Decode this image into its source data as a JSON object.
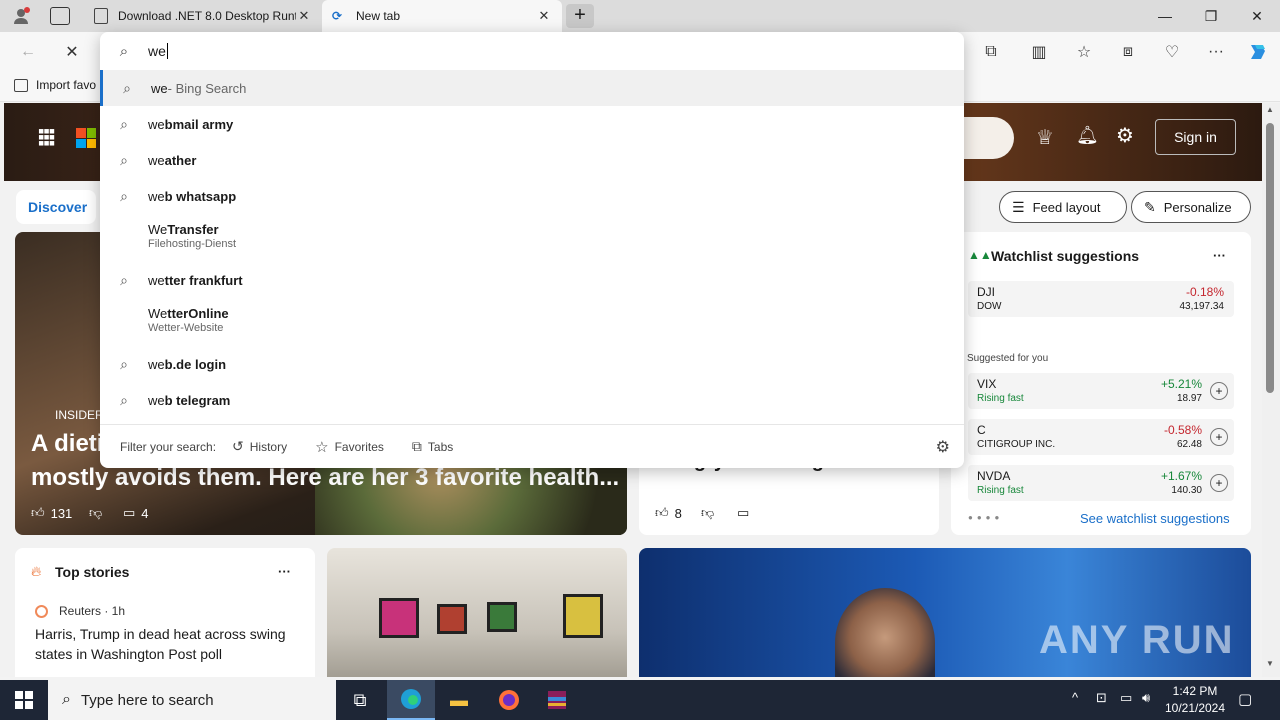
{
  "tabs": [
    {
      "title": "Download .NET 8.0 Desktop Runt",
      "close": "✕"
    },
    {
      "title": "New tab",
      "close": "✕"
    }
  ],
  "new_tab_symbol": "+",
  "window_controls": {
    "minimize": "—",
    "maximize": "❐",
    "close": "✕"
  },
  "favorites_bar": {
    "import_label": "Import favo"
  },
  "address": {
    "value": "we"
  },
  "suggestions": [
    {
      "typed": "we",
      "rest": " - Bing Search",
      "sub": "",
      "icon": "search-icon"
    },
    {
      "typed": "we",
      "rest": "bmail army",
      "sub": "",
      "icon": "search-icon"
    },
    {
      "typed": "we",
      "rest": "ather",
      "sub": "",
      "icon": "search-icon"
    },
    {
      "typed": "we",
      "rest": "b whatsapp",
      "sub": "",
      "icon": "search-icon"
    },
    {
      "typed": "We",
      "rest": "Transfer",
      "sub": "Filehosting-Dienst",
      "icon": ""
    },
    {
      "typed": "we",
      "rest": "tter frankfurt",
      "sub": "",
      "icon": "search-icon"
    },
    {
      "typed": "We",
      "rest": "tterOnline",
      "sub": "Wetter-Website",
      "icon": ""
    },
    {
      "typed": "we",
      "rest": "b.de login",
      "sub": "",
      "icon": "search-icon"
    },
    {
      "typed": "we",
      "rest": "b telegram",
      "sub": "",
      "icon": "search-icon"
    }
  ],
  "filter": {
    "label": "Filter your search:",
    "history": "History",
    "favorites": "Favorites",
    "tabs": "Tabs"
  },
  "msn": {
    "signin": "Sign in",
    "discover": "Discover",
    "feed_layout": "Feed layout",
    "personalize": "Personalize"
  },
  "hero_story": {
    "source": "INSIDER",
    "headline_1": "A dieti",
    "headline_2": "mostly avoids them. Here are her 3 favorite health...",
    "likes": "131",
    "comments": "4"
  },
  "middle_story": {
    "headline": "Hungry on semaglutide",
    "likes": "8"
  },
  "watchlist": {
    "title": "Watchlist suggestions",
    "more": "···",
    "top": {
      "symbol": "DJI",
      "name": "DOW",
      "change": "-0.18%",
      "price": "43,197.34"
    },
    "suggested_label": "Suggested for you",
    "items": [
      {
        "symbol": "VIX",
        "name": "Rising fast",
        "change": "+5.21%",
        "price": "18.97"
      },
      {
        "symbol": "C",
        "name": "CITIGROUP INC.",
        "change": "-0.58%",
        "price": "62.48"
      },
      {
        "symbol": "NVDA",
        "name": "Rising fast",
        "change": "+1.67%",
        "price": "140.30"
      }
    ],
    "see_more": "See watchlist suggestions"
  },
  "top_stories": {
    "title": "Top stories",
    "more": "···",
    "source": "Reuters · 1h",
    "headline": "Harris, Trump in dead heat across swing states in Washington Post poll"
  },
  "watermark": "ANY RUN",
  "taskbar": {
    "search_placeholder": "Type here to search",
    "time": "1:42 PM",
    "date": "10/21/2024"
  },
  "colors": {
    "accent": "#1a6fc9",
    "negative": "#c4262e",
    "positive": "#17873a"
  }
}
